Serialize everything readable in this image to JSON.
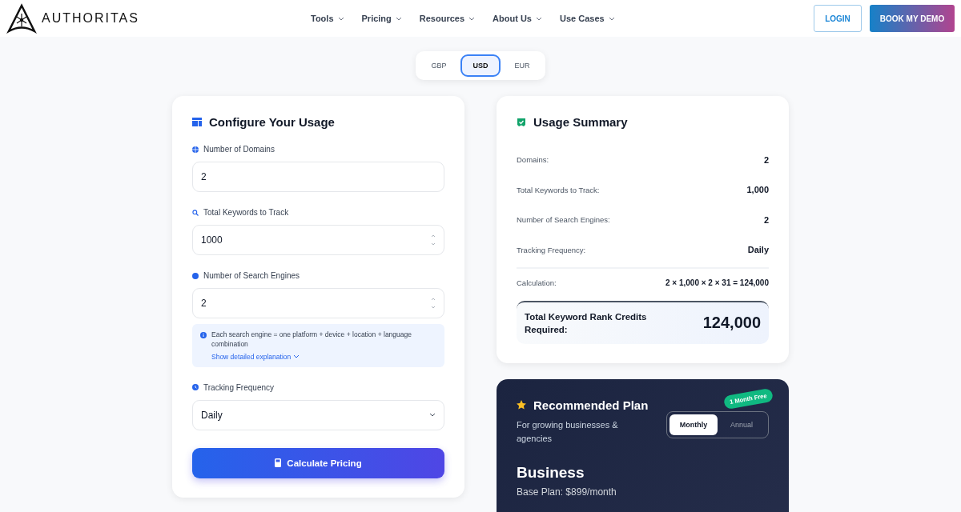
{
  "header": {
    "logo": "AUTHORITAS",
    "nav": [
      {
        "label": "Tools"
      },
      {
        "label": "Pricing"
      },
      {
        "label": "Resources"
      },
      {
        "label": "About Us"
      },
      {
        "label": "Use Cases"
      }
    ],
    "login": "LOGIN",
    "demo": "BOOK MY DEMO"
  },
  "currencies": [
    {
      "label": "GBP",
      "selected": false
    },
    {
      "label": "USD",
      "selected": true
    },
    {
      "label": "EUR",
      "selected": false
    }
  ],
  "configure": {
    "title": "Configure Your Usage",
    "fields": [
      {
        "kind": "text",
        "label": "Number of Domains",
        "value": "2"
      },
      {
        "kind": "number",
        "label": "Total Keywords to Track",
        "value": "1000"
      },
      {
        "kind": "number",
        "label": "Number of Search Engines",
        "value": "2",
        "note": "Each search engine = one platform + device + location + language combination",
        "note_link": "Show detailed explanation"
      },
      {
        "kind": "select",
        "label": "Tracking Frequency",
        "value": "Daily"
      }
    ],
    "button": "Calculate Pricing"
  },
  "summary": {
    "title": "Usage Summary",
    "rows": [
      {
        "label": "Domains:",
        "value": "2"
      },
      {
        "label": "Total Keywords to Track:",
        "value": "1,000"
      },
      {
        "label": "Number of Search Engines:",
        "value": "2"
      },
      {
        "label": "Tracking Frequency:",
        "value": "Daily"
      }
    ],
    "calculation_label": "Calculation:",
    "calculation": "2 × 1,000 × 2 × 31 = 124,000",
    "total_label": "Total Keyword Rank Credits Required:",
    "total": "124,000"
  },
  "plan": {
    "title": "Recommended Plan",
    "subtitle": "For growing businesses & agencies",
    "billing": [
      {
        "label": "Monthly",
        "selected": true
      },
      {
        "label": "Annual",
        "selected": false
      }
    ],
    "badge": "1 Month Free",
    "name": "Business",
    "base": "Base Plan: $899/month"
  }
}
